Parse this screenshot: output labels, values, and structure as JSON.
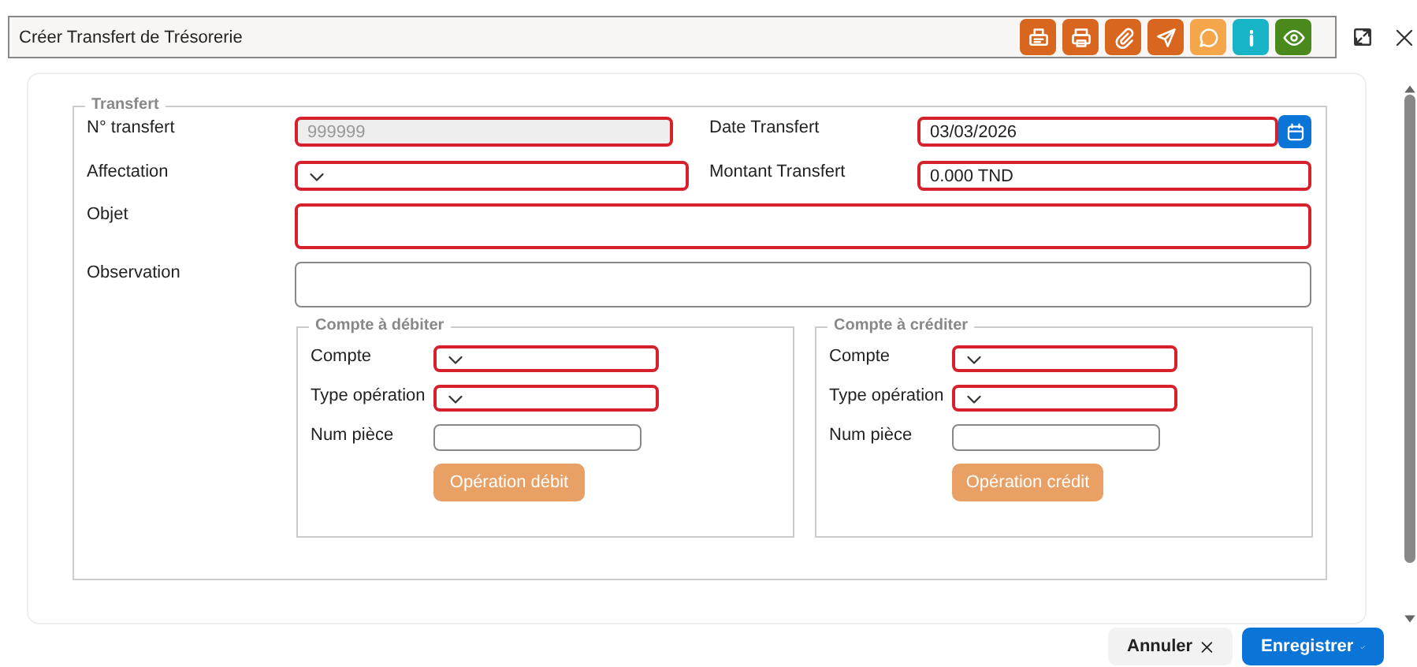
{
  "window": {
    "title": "Créer Transfert de Trésorerie"
  },
  "toolbar": [
    {
      "kind": "fax",
      "color": "#d9661f"
    },
    {
      "kind": "print",
      "color": "#d9661f"
    },
    {
      "kind": "attach",
      "color": "#d9661f"
    },
    {
      "kind": "send",
      "color": "#d9661f"
    },
    {
      "kind": "chat",
      "color": "#f5a54a"
    },
    {
      "kind": "info",
      "color": "#17b3c7"
    },
    {
      "kind": "view",
      "color": "#4a8a1c"
    }
  ],
  "form": {
    "legend": "Transfert",
    "fields": [
      {
        "label": "N° transfert",
        "kind": "text",
        "value": "999999",
        "disabled": true,
        "required": true
      },
      {
        "label": "Date Transfert",
        "kind": "date",
        "value": "03/03/2026",
        "disabled": false,
        "required": true
      },
      {
        "label": "Affectation",
        "kind": "select",
        "disabled": false,
        "required": true
      },
      {
        "label": "Montant Transfert",
        "kind": "text",
        "value": "0.000 TND",
        "disabled": false,
        "required": true
      },
      {
        "label": "Objet",
        "kind": "area",
        "disabled": false,
        "required": true
      },
      {
        "label": "Observation",
        "kind": "area",
        "disabled": false,
        "required": false
      }
    ],
    "panels": [
      {
        "legend": "Compte à débiter",
        "fields": [
          {
            "label": "Compte",
            "kind": "select",
            "required": true
          },
          {
            "label": "Type opération",
            "kind": "select",
            "required": true
          },
          {
            "label": "Num pièce",
            "kind": "text",
            "required": false
          }
        ],
        "button": "Opération débit"
      },
      {
        "legend": "Compte à créditer",
        "fields": [
          {
            "label": "Compte",
            "kind": "select",
            "required": true
          },
          {
            "label": "Type opération",
            "kind": "select",
            "required": true
          },
          {
            "label": "Num pièce",
            "kind": "text",
            "required": false
          }
        ],
        "button": "Opération crédit"
      }
    ]
  },
  "footer": [
    {
      "label": "Annuler",
      "kind": "cancel"
    },
    {
      "label": "Enregistrer",
      "kind": "save"
    }
  ]
}
